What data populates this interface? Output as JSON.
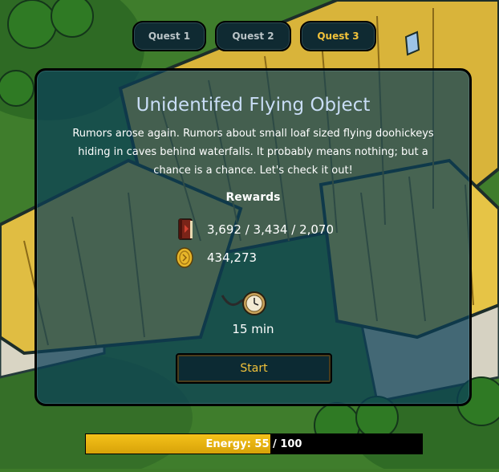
{
  "tabs": [
    {
      "label": "Quest 1",
      "active": false
    },
    {
      "label": "Quest 2",
      "active": false
    },
    {
      "label": "Quest 3",
      "active": true
    }
  ],
  "quest": {
    "title": "Unidentifed Flying Object",
    "description": "Rumors arose again. Rumors about small loaf sized flying doohickeys hiding in caves behind waterfalls. It probably means nothing; but a chance is a chance. Let's check it out!",
    "rewards_title": "Rewards",
    "rewards": [
      {
        "icon": "book-icon",
        "value": "3,692 / 3,434 / 2,070"
      },
      {
        "icon": "coin-icon",
        "value": "434,273"
      }
    ],
    "duration_icon": "pocket-watch-icon",
    "duration": "15 min",
    "start_label": "Start"
  },
  "energy": {
    "label": "Energy: 55",
    "separator": " / 100",
    "current": 55,
    "max": 100
  },
  "colors": {
    "accent": "#f2c23a",
    "panel": "#0a3e58",
    "tab": "#0f2a32",
    "energy": "#f5c21a"
  }
}
